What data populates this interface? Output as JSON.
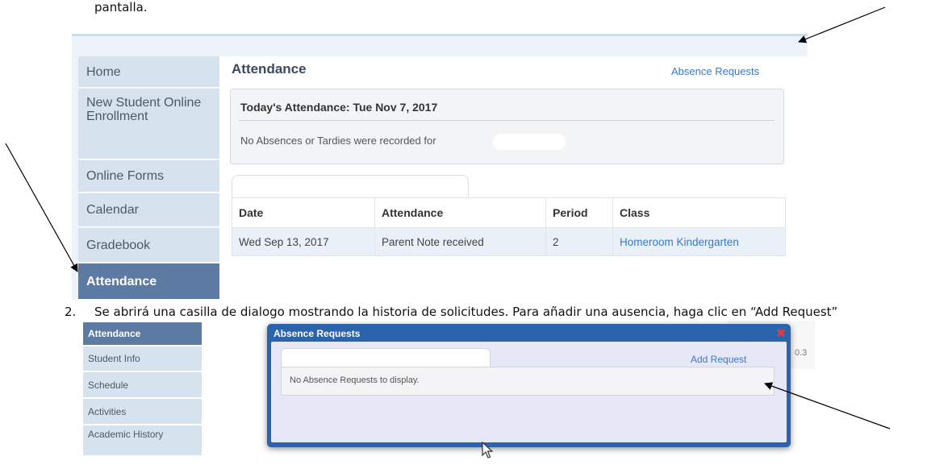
{
  "doc": {
    "top_fragment": "pantalla.",
    "step2_number": "2.",
    "step2_text": "Se abrirá una casilla de dialogo mostrando la historia de solicitudes. Para añadir una ausencia, haga clic en “Add Request”"
  },
  "screenshot1": {
    "nav": [
      "Home",
      "New Student Online Enrollment",
      "Online Forms",
      "Calendar",
      "Gradebook",
      "Attendance"
    ],
    "nav_active": "Attendance",
    "title": "Attendance",
    "absence_requests_link": "Absence Requests",
    "today_title": "Today's Attendance: Tue Nov 7, 2017",
    "today_message": "No Absences or Tardies were recorded for",
    "table": {
      "headers": [
        "Date",
        "Attendance",
        "Period",
        "Class"
      ],
      "rows": [
        [
          "Wed Sep 13, 2017",
          "Parent Note received",
          "2",
          "Homeroom Kindergarten"
        ]
      ]
    }
  },
  "screenshot2": {
    "nav": [
      "Attendance",
      "Student Info",
      "Schedule",
      "Activities",
      "Academic History"
    ],
    "nav_active": "Attendance",
    "dialog_title": "Absence Requests",
    "add_request": "Add Request",
    "empty_message": "No Absence Requests to display.",
    "bg_fragment": "0.3",
    "close_icon": "close-x-icon"
  },
  "colors": {
    "nav_bg": "#d6e2ee",
    "nav_active_bg": "#5c7aa2",
    "link": "#3a78c3",
    "dialog_header": "#2b64ad",
    "close_red": "#e23b3b"
  }
}
